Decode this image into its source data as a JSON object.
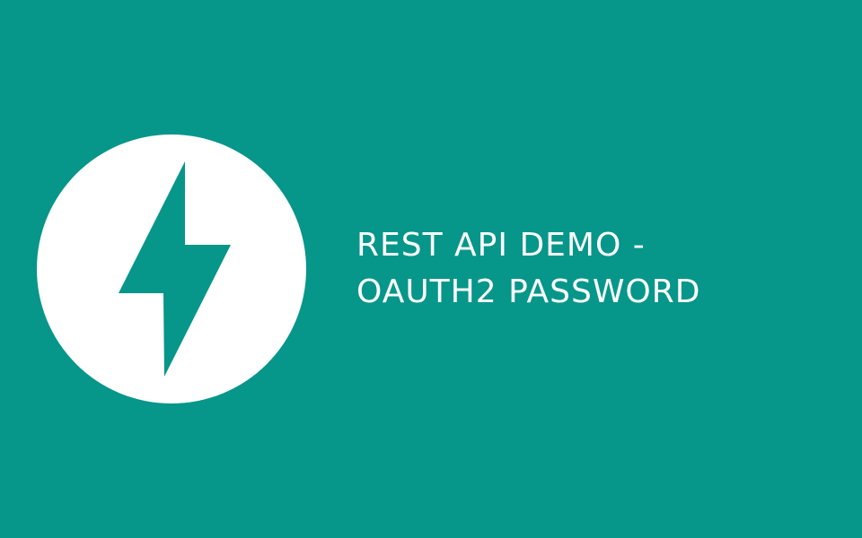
{
  "colors": {
    "background": "#06968A",
    "logo_circle": "#FFFFFF",
    "bolt": "#06968A",
    "title_text": "#FFFFFF"
  },
  "logo": {
    "icon": "lightning-bolt-icon"
  },
  "title": {
    "line1": "REST API DEMO -",
    "line2": "OAUTH2 PASSWORD"
  }
}
